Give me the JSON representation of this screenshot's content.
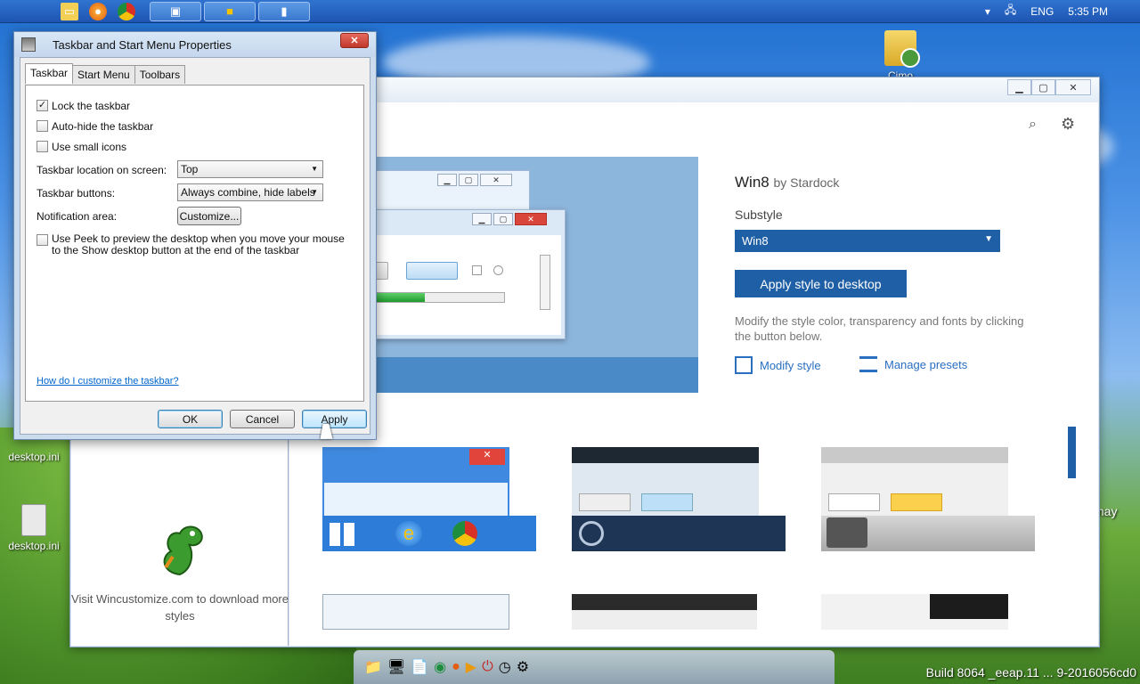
{
  "taskbar": {
    "quick_icons": [
      "folder-icon",
      "firefox-icon",
      "chrome-icon"
    ],
    "buttons": [
      "control-panel-icon",
      "win-flag-icon",
      "taskbar-props-icon"
    ],
    "lang": "ENG",
    "time": "5:35 PM"
  },
  "desktop": {
    "icons": [
      {
        "label": "Cimo"
      },
      {
        "label": "desktop.ini"
      },
      {
        "label": "desktop.ini"
      }
    ],
    "partial_text": "may",
    "build_text": "Build 8064 _eeap.11 ... 9-2016056cd0"
  },
  "win8_app": {
    "style_name": "Win8",
    "style_by": "by Stardock",
    "substyle_label": "Substyle",
    "substyle_value": "Win8",
    "apply_button": "Apply style to desktop",
    "modify_text": "Modify the style color, transparency and fonts by clicking the button below.",
    "modify_link": "Modify style",
    "presets_link": "Manage presets",
    "wincustomize_text": "Visit Wincustomize.com to download more styles"
  },
  "dialog": {
    "title": "Taskbar and Start Menu Properties",
    "tabs": [
      "Taskbar",
      "Start Menu",
      "Toolbars"
    ],
    "checkboxes": [
      {
        "label": "Lock the taskbar",
        "checked": true
      },
      {
        "label": "Auto-hide the taskbar",
        "checked": false
      },
      {
        "label": "Use small icons",
        "checked": false
      }
    ],
    "location_label": "Taskbar location on screen:",
    "location_value": "Top",
    "buttons_label": "Taskbar buttons:",
    "buttons_value": "Always combine, hide labels",
    "notification_label": "Notification area:",
    "customize_button": "Customize...",
    "peek_label": "Use Peek to preview the desktop when you move your mouse to the Show desktop button at the end of the taskbar",
    "help_link": "How do I customize the taskbar?",
    "ok": "OK",
    "cancel": "Cancel",
    "apply": "Apply"
  }
}
